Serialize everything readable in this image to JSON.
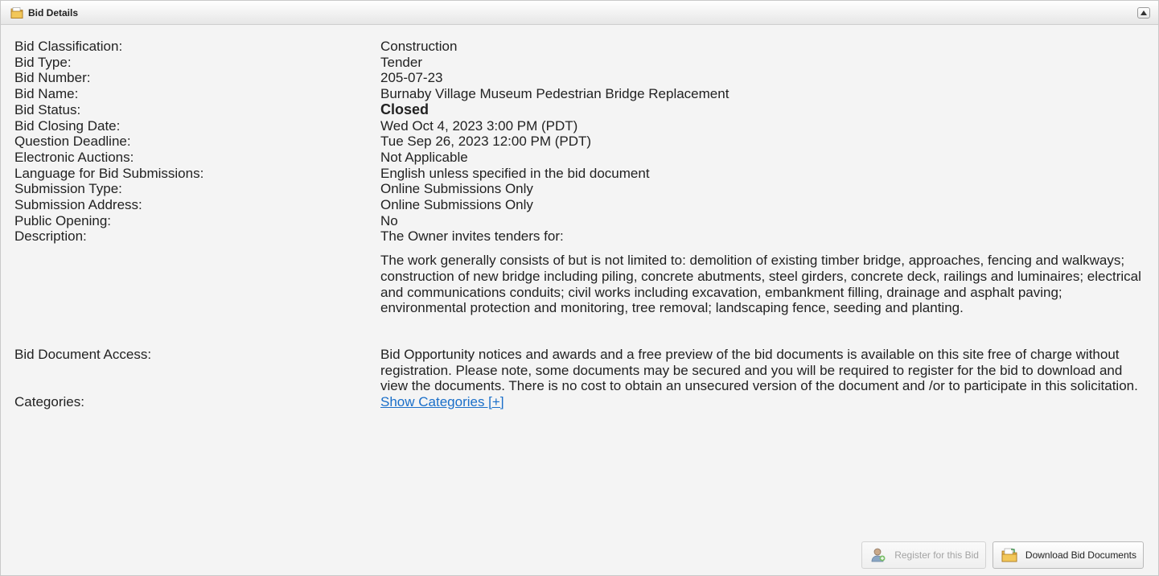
{
  "panel": {
    "title": "Bid Details",
    "icon": "folder-icon",
    "collapse_icon": "chevron-up-icon"
  },
  "details": [
    {
      "label": "Bid Classification:",
      "value": "Construction"
    },
    {
      "label": "Bid Type:",
      "value": "Tender"
    },
    {
      "label": "Bid Number:",
      "value": "205-07-23"
    },
    {
      "label": "Bid Name:",
      "value": "Burnaby Village Museum Pedestrian Bridge Replacement"
    },
    {
      "label": "Bid Status:",
      "value": "Closed"
    },
    {
      "label": "Bid Closing Date:",
      "value": "Wed Oct 4, 2023 3:00 PM (PDT)"
    },
    {
      "label": "Question Deadline:",
      "value": "Tue Sep 26, 2023 12:00 PM (PDT)"
    },
    {
      "label": "Electronic Auctions:",
      "value": "Not Applicable"
    },
    {
      "label": "Language for Bid Submissions:",
      "value": "English unless specified in the bid document"
    },
    {
      "label": "Submission Type:",
      "value": "Online Submissions Only"
    },
    {
      "label": "Submission Address:",
      "value": "Online Submissions Only"
    },
    {
      "label": "Public Opening:",
      "value": "No"
    }
  ],
  "description": {
    "label": "Description:",
    "intro": "The Owner invites tenders for:",
    "body": "The work generally consists of but is not limited to: demolition of existing timber bridge, approaches, fencing and walkways; construction of new bridge including piling, concrete abutments, steel girders, concrete deck, railings and luminaires; electrical and communications conduits; civil works including excavation, embankment filling, drainage and asphalt paving; environmental protection and monitoring, tree removal; landscaping fence, seeding and planting."
  },
  "document_access": {
    "label": "Bid Document Access:",
    "value": "Bid Opportunity notices and awards and a free preview of the bid documents is available on this site free of charge without registration. Please note, some documents may be secured and you will be required to register for the bid to download and view the documents. There is no cost to obtain an unsecured version of the document and /or to participate in this solicitation."
  },
  "categories": {
    "label": "Categories:",
    "link": "Show Categories [+]"
  },
  "buttons": {
    "register": "Register for this Bid",
    "download": "Download Bid Documents"
  },
  "colors": {
    "link": "#1a6fc9",
    "background": "#f4f4f4"
  }
}
